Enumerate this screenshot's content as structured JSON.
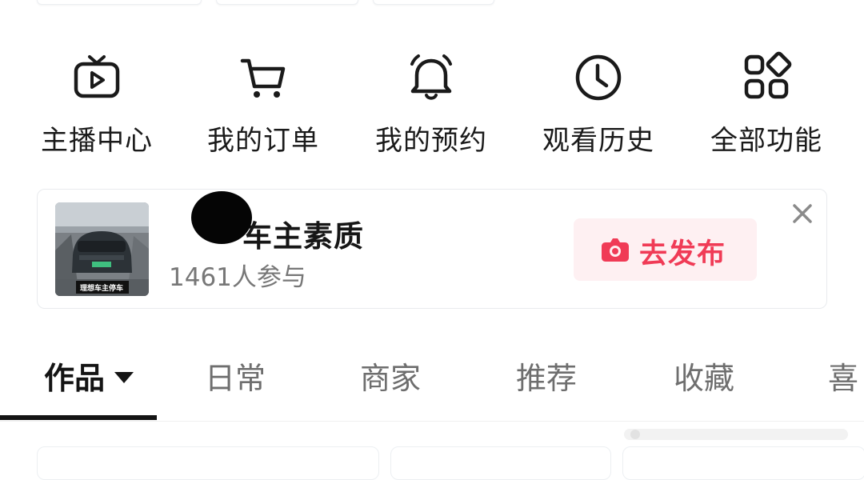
{
  "quick_actions": [
    {
      "label": "主播中心",
      "icon": "tv-play-icon"
    },
    {
      "label": "我的订单",
      "icon": "cart-icon"
    },
    {
      "label": "我的预约",
      "icon": "bell-icon"
    },
    {
      "label": "观看历史",
      "icon": "clock-icon"
    },
    {
      "label": "全部功能",
      "icon": "grid-icon"
    }
  ],
  "topic_card": {
    "title": "车主素质",
    "participants": "1461人参与",
    "thumbnail_caption": "理想车主停车 作业",
    "thumbnail_plate": "",
    "publish_label": "去发布",
    "close_glyph": "×"
  },
  "tabs": [
    {
      "label": "作品",
      "active": true
    },
    {
      "label": "日常"
    },
    {
      "label": "商家"
    },
    {
      "label": "推荐"
    },
    {
      "label": "收藏"
    },
    {
      "label": "喜"
    }
  ],
  "colors": {
    "accent": "#f03b56",
    "accent_bg": "#fef0f2",
    "text_primary": "#1a1a1a",
    "text_secondary": "#777777",
    "tab_inactive": "#6e6e6e"
  }
}
